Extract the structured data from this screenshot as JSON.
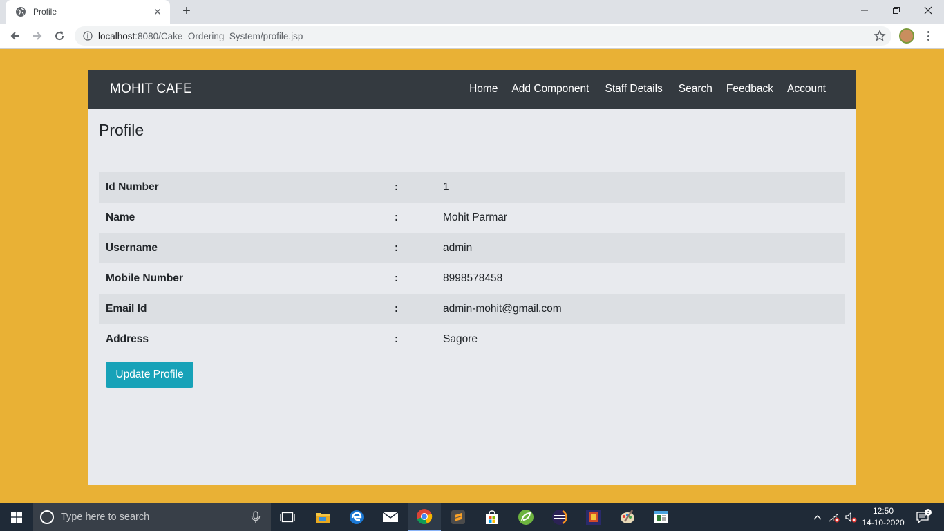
{
  "browser": {
    "tab_title": "Profile",
    "new_tab_symbol": "+",
    "url_host": "localhost",
    "url_rest": ":8080/Cake_Ordering_System/profile.jsp"
  },
  "navbar": {
    "brand": "MOHIT CAFE",
    "links": [
      "Home",
      "Add Component",
      "Staff Details",
      "Search",
      "Feedback",
      "Account"
    ]
  },
  "page": {
    "title": "Profile",
    "separator": ":",
    "rows": [
      {
        "label": "Id Number",
        "value": "1"
      },
      {
        "label": "Name",
        "value": "Mohit Parmar"
      },
      {
        "label": "Username",
        "value": "admin"
      },
      {
        "label": "Mobile Number",
        "value": "8998578458"
      },
      {
        "label": "Email Id",
        "value": "admin-mohit@gmail.com"
      },
      {
        "label": "Address",
        "value": "Sagore"
      }
    ],
    "update_button": "Update Profile"
  },
  "taskbar": {
    "search_placeholder": "Type here to search",
    "time": "12:50",
    "date": "14-10-2020",
    "apps": [
      "task-view-icon",
      "file-explorer-icon",
      "edge-icon",
      "mail-icon",
      "chrome-icon",
      "sublime-icon",
      "store-icon",
      "spring-icon",
      "eclipse-icon",
      "game-icon",
      "paint-icon",
      "notepad-icon"
    ]
  },
  "colors": {
    "page_background": "#e9b135",
    "navbar": "#343a40",
    "button": "#17a2b8",
    "taskbar": "#1f2a37"
  }
}
